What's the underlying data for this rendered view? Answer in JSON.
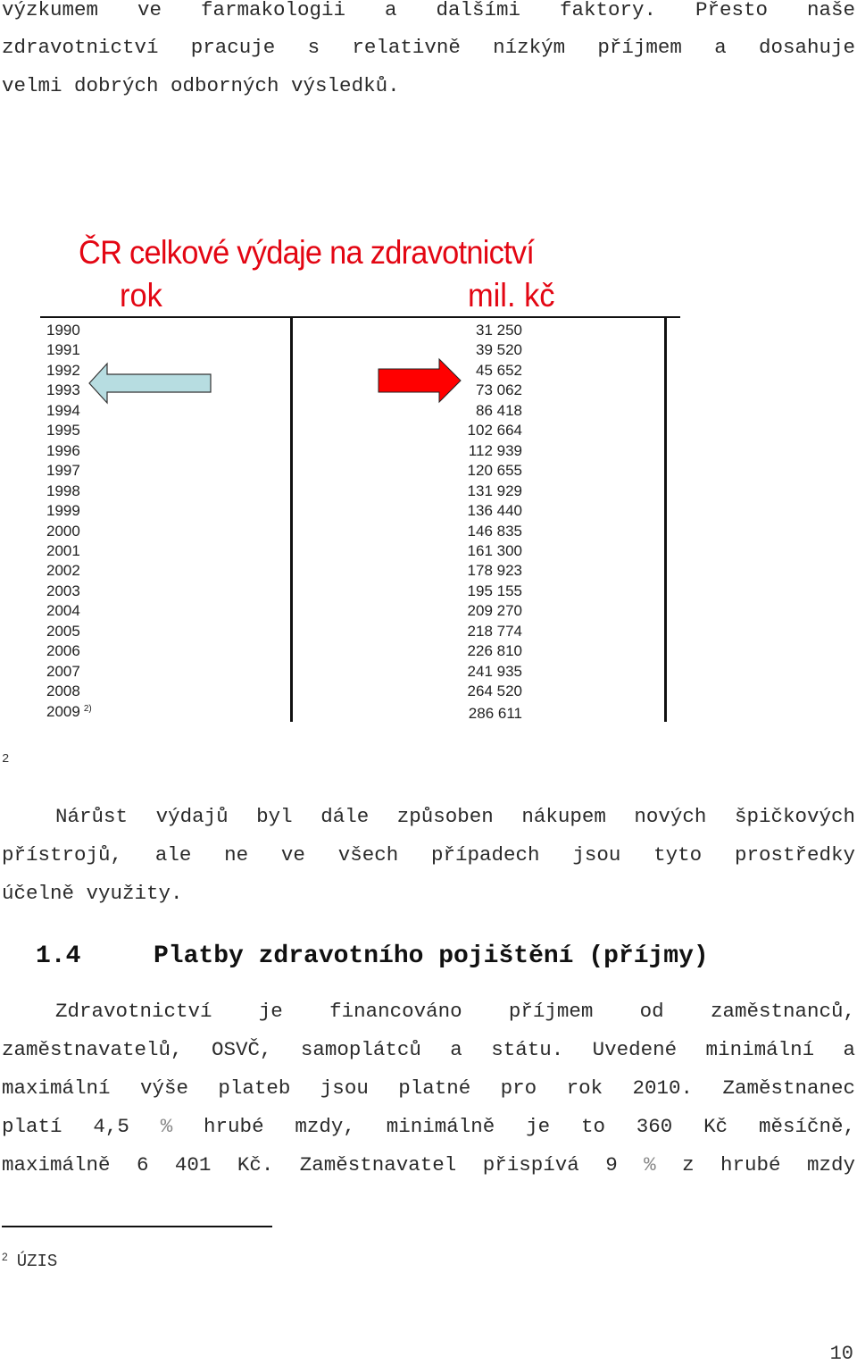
{
  "intro_paragraph": {
    "lines": [
      "výzkumem ve farmakologii a dalšími faktory. Přesto naše",
      "zdravotnictví pracuje s relativně nízkým příjmem a dosahuje",
      "velmi dobrých odborných výsledků."
    ]
  },
  "figure": {
    "title": "ČR celkové výdaje na zdravotnictví",
    "col_year_header": "rok",
    "col_value_header": "mil. kč",
    "left_arrow_icon": "arrow-left-icon",
    "right_arrow_icon": "arrow-right-icon",
    "colors": {
      "title": "#e30613",
      "left_arrow": "#b7dde1",
      "right_arrow": "#ff0000"
    },
    "rows": [
      {
        "year": "1990",
        "value": "31 250"
      },
      {
        "year": "1991",
        "value": "39 520"
      },
      {
        "year": "1992",
        "value": "45 652"
      },
      {
        "year": "1993",
        "value": "73 062"
      },
      {
        "year": "1994",
        "value": "86 418"
      },
      {
        "year": "1995",
        "value": "102 664"
      },
      {
        "year": "1996",
        "value": "112 939"
      },
      {
        "year": "1997",
        "value": "120 655"
      },
      {
        "year": "1998",
        "value": "131 929"
      },
      {
        "year": "1999",
        "value": "136 440"
      },
      {
        "year": "2000",
        "value": "146 835"
      },
      {
        "year": "2001",
        "value": "161 300"
      },
      {
        "year": "2002",
        "value": "178 923"
      },
      {
        "year": "2003",
        "value": "195 155"
      },
      {
        "year": "2004",
        "value": "209 270"
      },
      {
        "year": "2005",
        "value": "218 774"
      },
      {
        "year": "2006",
        "value": "226 810"
      },
      {
        "year": "2007",
        "value": "241 935"
      },
      {
        "year": "2008",
        "value": "264 520"
      },
      {
        "year": "2009",
        "value": "286 611",
        "note": "2)"
      }
    ]
  },
  "footnote_marker": "2",
  "paragraph_2": {
    "lines": [
      "Nárůst výdajů byl dále způsoben nákupem nových špičkových",
      "přístrojů, ale ne ve všech případech jsou tyto prostředky",
      "účelně využity."
    ]
  },
  "section": {
    "number": "1.4",
    "title": "Platby zdravotního pojištění (příjmy)"
  },
  "paragraph_3": {
    "lines": [
      "Zdravotnictví je financováno příjmem od zaměstnanců,",
      "zaměstnavatelů, OSVČ, samoplátců a státu. Uvedené minimální a",
      "maximální výše plateb jsou platné pro rok 2010. Zaměstnanec",
      [
        "platí 4,5 ",
        "%",
        " hrubé mzdy, minimálně je to 360 Kč měsíčně,"
      ],
      [
        "maximálně 6 401 Kč. Zaměstnavatel přispívá 9 ",
        "%",
        " z hrubé mzdy"
      ]
    ]
  },
  "footnote": {
    "marker": "2",
    "text": "ÚZIS"
  },
  "page_number": "10"
}
